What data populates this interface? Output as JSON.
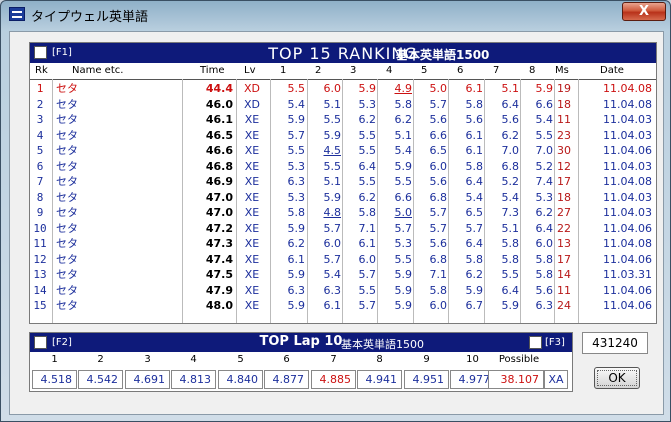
{
  "window": {
    "title": "タイプウェル英単語",
    "close_label": "X"
  },
  "ranking": {
    "f_label": "[F1]",
    "title": "TOP 15  RANKING",
    "set_name": "基本英単語1500",
    "headers": {
      "rk": "Rk",
      "name": "Name etc.",
      "time": "Time",
      "lv": "Lv",
      "laps": [
        "1",
        "2",
        "3",
        "4",
        "5",
        "6",
        "7",
        "8"
      ],
      "ms": "Ms",
      "date": "Date"
    },
    "rows": [
      {
        "rk": "1",
        "name": "セタ",
        "time": "44.4",
        "lv": "XD",
        "laps": [
          "5.5",
          "6.0",
          "5.9",
          "4.9",
          "5.0",
          "6.1",
          "5.1",
          "5.9"
        ],
        "ms": "19",
        "date": "11.04.08"
      },
      {
        "rk": "2",
        "name": "セタ",
        "time": "46.0",
        "lv": "XD",
        "laps": [
          "5.4",
          "5.1",
          "5.3",
          "5.8",
          "5.7",
          "5.8",
          "6.4",
          "6.6"
        ],
        "ms": "18",
        "date": "11.04.08"
      },
      {
        "rk": "3",
        "name": "セタ",
        "time": "46.1",
        "lv": "XE",
        "laps": [
          "5.9",
          "5.5",
          "6.2",
          "6.2",
          "5.6",
          "5.6",
          "5.6",
          "5.4"
        ],
        "ms": "11",
        "date": "11.04.03"
      },
      {
        "rk": "4",
        "name": "セタ",
        "time": "46.5",
        "lv": "XE",
        "laps": [
          "5.7",
          "5.9",
          "5.5",
          "5.1",
          "6.6",
          "6.1",
          "6.2",
          "5.5"
        ],
        "ms": "23",
        "date": "11.04.03"
      },
      {
        "rk": "5",
        "name": "セタ",
        "time": "46.6",
        "lv": "XE",
        "laps": [
          "5.5",
          "4.5",
          "5.5",
          "5.4",
          "6.5",
          "6.1",
          "7.0",
          "7.0"
        ],
        "ms": "30",
        "date": "11.04.06"
      },
      {
        "rk": "6",
        "name": "セタ",
        "time": "46.8",
        "lv": "XE",
        "laps": [
          "5.3",
          "5.5",
          "6.4",
          "5.9",
          "6.0",
          "5.8",
          "6.8",
          "5.2"
        ],
        "ms": "12",
        "date": "11.04.03"
      },
      {
        "rk": "7",
        "name": "セタ",
        "time": "46.9",
        "lv": "XE",
        "laps": [
          "6.3",
          "5.1",
          "5.5",
          "5.5",
          "5.6",
          "6.4",
          "5.2",
          "7.4"
        ],
        "ms": "17",
        "date": "11.04.08"
      },
      {
        "rk": "8",
        "name": "セタ",
        "time": "47.0",
        "lv": "XE",
        "laps": [
          "5.3",
          "5.9",
          "6.2",
          "6.6",
          "6.8",
          "5.4",
          "5.4",
          "5.3"
        ],
        "ms": "18",
        "date": "11.04.03"
      },
      {
        "rk": "9",
        "name": "セタ",
        "time": "47.0",
        "lv": "XE",
        "laps": [
          "5.8",
          "4.8",
          "5.8",
          "5.0",
          "5.7",
          "6.5",
          "7.3",
          "6.2"
        ],
        "ms": "27",
        "date": "11.04.03"
      },
      {
        "rk": "10",
        "name": "セタ",
        "time": "47.2",
        "lv": "XE",
        "laps": [
          "5.9",
          "5.7",
          "7.1",
          "5.7",
          "5.7",
          "5.7",
          "5.1",
          "6.4"
        ],
        "ms": "22",
        "date": "11.04.06"
      },
      {
        "rk": "11",
        "name": "セタ",
        "time": "47.3",
        "lv": "XE",
        "laps": [
          "6.2",
          "6.0",
          "6.1",
          "5.3",
          "5.6",
          "6.4",
          "5.8",
          "6.0"
        ],
        "ms": "13",
        "date": "11.04.08"
      },
      {
        "rk": "12",
        "name": "セタ",
        "time": "47.4",
        "lv": "XE",
        "laps": [
          "6.1",
          "5.7",
          "6.0",
          "5.5",
          "6.8",
          "5.8",
          "5.8",
          "5.8"
        ],
        "ms": "17",
        "date": "11.04.06"
      },
      {
        "rk": "13",
        "name": "セタ",
        "time": "47.5",
        "lv": "XE",
        "laps": [
          "5.9",
          "5.4",
          "5.7",
          "5.9",
          "7.1",
          "6.2",
          "5.5",
          "5.8"
        ],
        "ms": "14",
        "date": "11.03.31"
      },
      {
        "rk": "14",
        "name": "セタ",
        "time": "47.9",
        "lv": "XE",
        "laps": [
          "6.3",
          "6.3",
          "5.5",
          "5.9",
          "5.8",
          "5.9",
          "6.4",
          "5.6"
        ],
        "ms": "11",
        "date": "11.04.06"
      },
      {
        "rk": "15",
        "name": "セタ",
        "time": "48.0",
        "lv": "XE",
        "laps": [
          "5.9",
          "6.1",
          "5.7",
          "5.9",
          "6.0",
          "6.7",
          "5.9",
          "6.3"
        ],
        "ms": "24",
        "date": "11.04.06"
      }
    ],
    "underlined": [
      [
        0,
        3
      ],
      [
        4,
        1
      ],
      [
        8,
        1
      ],
      [
        8,
        3
      ]
    ],
    "colors": {
      "highlight": "#cc1010",
      "text": "#1c2f9c",
      "header_bg": "#0e1a7a"
    }
  },
  "lap": {
    "f2_label": "[F2]",
    "f3_label": "[F3]",
    "title": "TOP Lap 10",
    "set_name": "基本英単語1500",
    "numbers": [
      "1",
      "2",
      "3",
      "4",
      "5",
      "6",
      "7",
      "8",
      "9",
      "10"
    ],
    "values": [
      "4.518",
      "4.542",
      "4.691",
      "4.813",
      "4.840",
      "4.877",
      "4.885",
      "4.941",
      "4.951",
      "4.977"
    ],
    "possible_label": "Possible",
    "possible_value": "38.107",
    "possible_level": "XA"
  },
  "score": "431240",
  "ok_label": "OK"
}
